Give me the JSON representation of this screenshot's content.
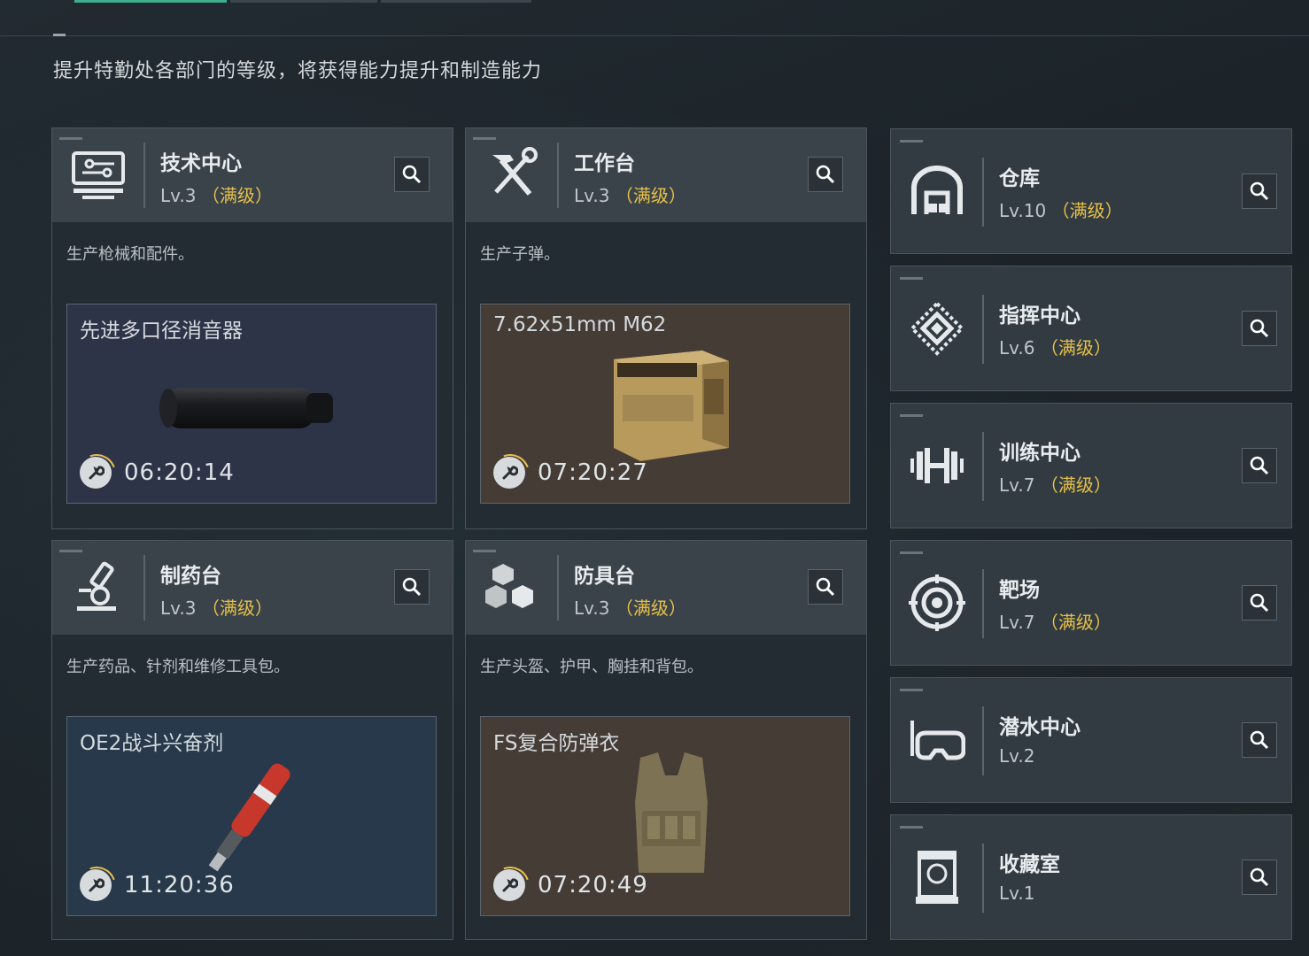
{
  "subtitle": "提升特勤处各部门的等级，将获得能力提升和制造能力",
  "cards": [
    {
      "name": "技术中心",
      "level": "Lv.3",
      "status": "（满级）",
      "desc": "生产枪械和配件。",
      "production": {
        "item": "先进多口径消音器",
        "time": "06:20:14",
        "bg": "#2e3448"
      },
      "icon": "computer-icon"
    },
    {
      "name": "工作台",
      "level": "Lv.3",
      "status": "（满级）",
      "desc": "生产子弹。",
      "production": {
        "item": "7.62x51mm M62",
        "time": "07:20:27",
        "bg": "#463c36"
      },
      "icon": "hammer-wrench-icon"
    },
    {
      "name": "制药台",
      "level": "Lv.3",
      "status": "（满级）",
      "desc": "生产药品、针剂和维修工具包。",
      "production": {
        "item": "OE2战斗兴奋剂",
        "time": "11:20:36",
        "bg": "#27394a"
      },
      "icon": "microscope-icon"
    },
    {
      "name": "防具台",
      "level": "Lv.3",
      "status": "（满级）",
      "desc": "生产头盔、护甲、胸挂和背包。",
      "production": {
        "item": "FS复合防弹衣",
        "time": "07:20:49",
        "bg": "#463c36"
      },
      "icon": "cubes-icon"
    }
  ],
  "side": [
    {
      "name": "仓库",
      "level": "Lv.10",
      "status": "（满级）",
      "icon": "warehouse-icon"
    },
    {
      "name": "指挥中心",
      "level": "Lv.6",
      "status": "（满级）",
      "icon": "command-chip-icon"
    },
    {
      "name": "训练中心",
      "level": "Lv.7",
      "status": "（满级）",
      "icon": "dumbbell-icon"
    },
    {
      "name": "靶场",
      "level": "Lv.7",
      "status": "（满级）",
      "icon": "target-icon"
    },
    {
      "name": "潜水中心",
      "level": "Lv.2",
      "status": "",
      "icon": "diving-mask-icon"
    },
    {
      "name": "收藏室",
      "level": "Lv.1",
      "status": "",
      "icon": "display-case-icon"
    }
  ],
  "colors": {
    "accent": "#3fae8c",
    "maxed": "#e7c04a"
  }
}
